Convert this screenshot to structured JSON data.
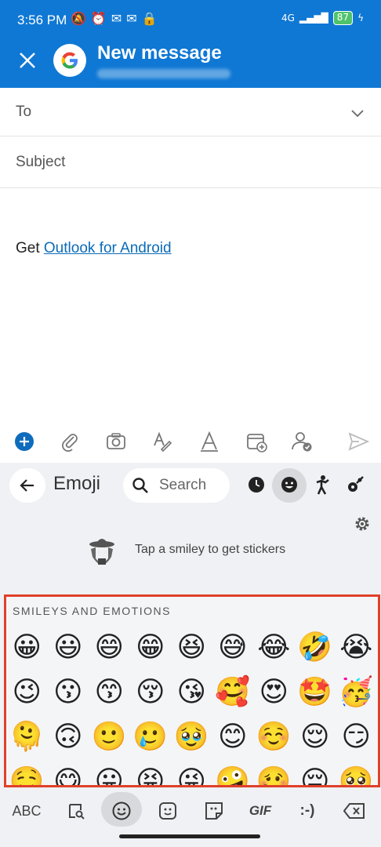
{
  "status_bar": {
    "time": "3:56 PM",
    "network": "4G",
    "battery": "87"
  },
  "header": {
    "title": "New message",
    "close_icon": "close-icon",
    "account_icon": "google-icon"
  },
  "compose": {
    "to_label": "To",
    "subject_label": "Subject",
    "body_prefix": "Get ",
    "body_link": "Outlook for Android"
  },
  "toolbar": {
    "items": [
      "add-icon",
      "attach-icon",
      "camera-icon",
      "format-text-icon",
      "draw-icon",
      "calendar-add-icon",
      "availability-icon",
      "send-icon"
    ]
  },
  "keyboard": {
    "title": "Emoji",
    "search_placeholder": "Search",
    "categories": [
      "recent-icon",
      "smiley-icon",
      "activity-icon",
      "objects-icon"
    ],
    "sticker_hint": "Tap a smiley to get stickers",
    "section_title": "SMILEYS AND EMOTIONS",
    "emojis": [
      "😀",
      "😃",
      "😄",
      "😁",
      "😆",
      "😅",
      "😂",
      "🤣",
      "😭",
      "😉",
      "😗",
      "😙",
      "😚",
      "😘",
      "🥰",
      "😍",
      "🤩",
      "🥳",
      "🫠",
      "🙃",
      "🙂",
      "🥲",
      "🥹",
      "😊",
      "☺️",
      "😌",
      "😏",
      "🤤",
      "😋",
      "😛",
      "😝",
      "😜",
      "🤪",
      "🥴",
      "😔",
      "🥺"
    ],
    "bottom": {
      "abc_label": "ABC",
      "gif_label": "GIF",
      "emoticon_label": ":-)"
    }
  },
  "colors": {
    "header_blue": "#0f78d4",
    "link": "#0b6bb8",
    "highlight": "#e0402a"
  }
}
